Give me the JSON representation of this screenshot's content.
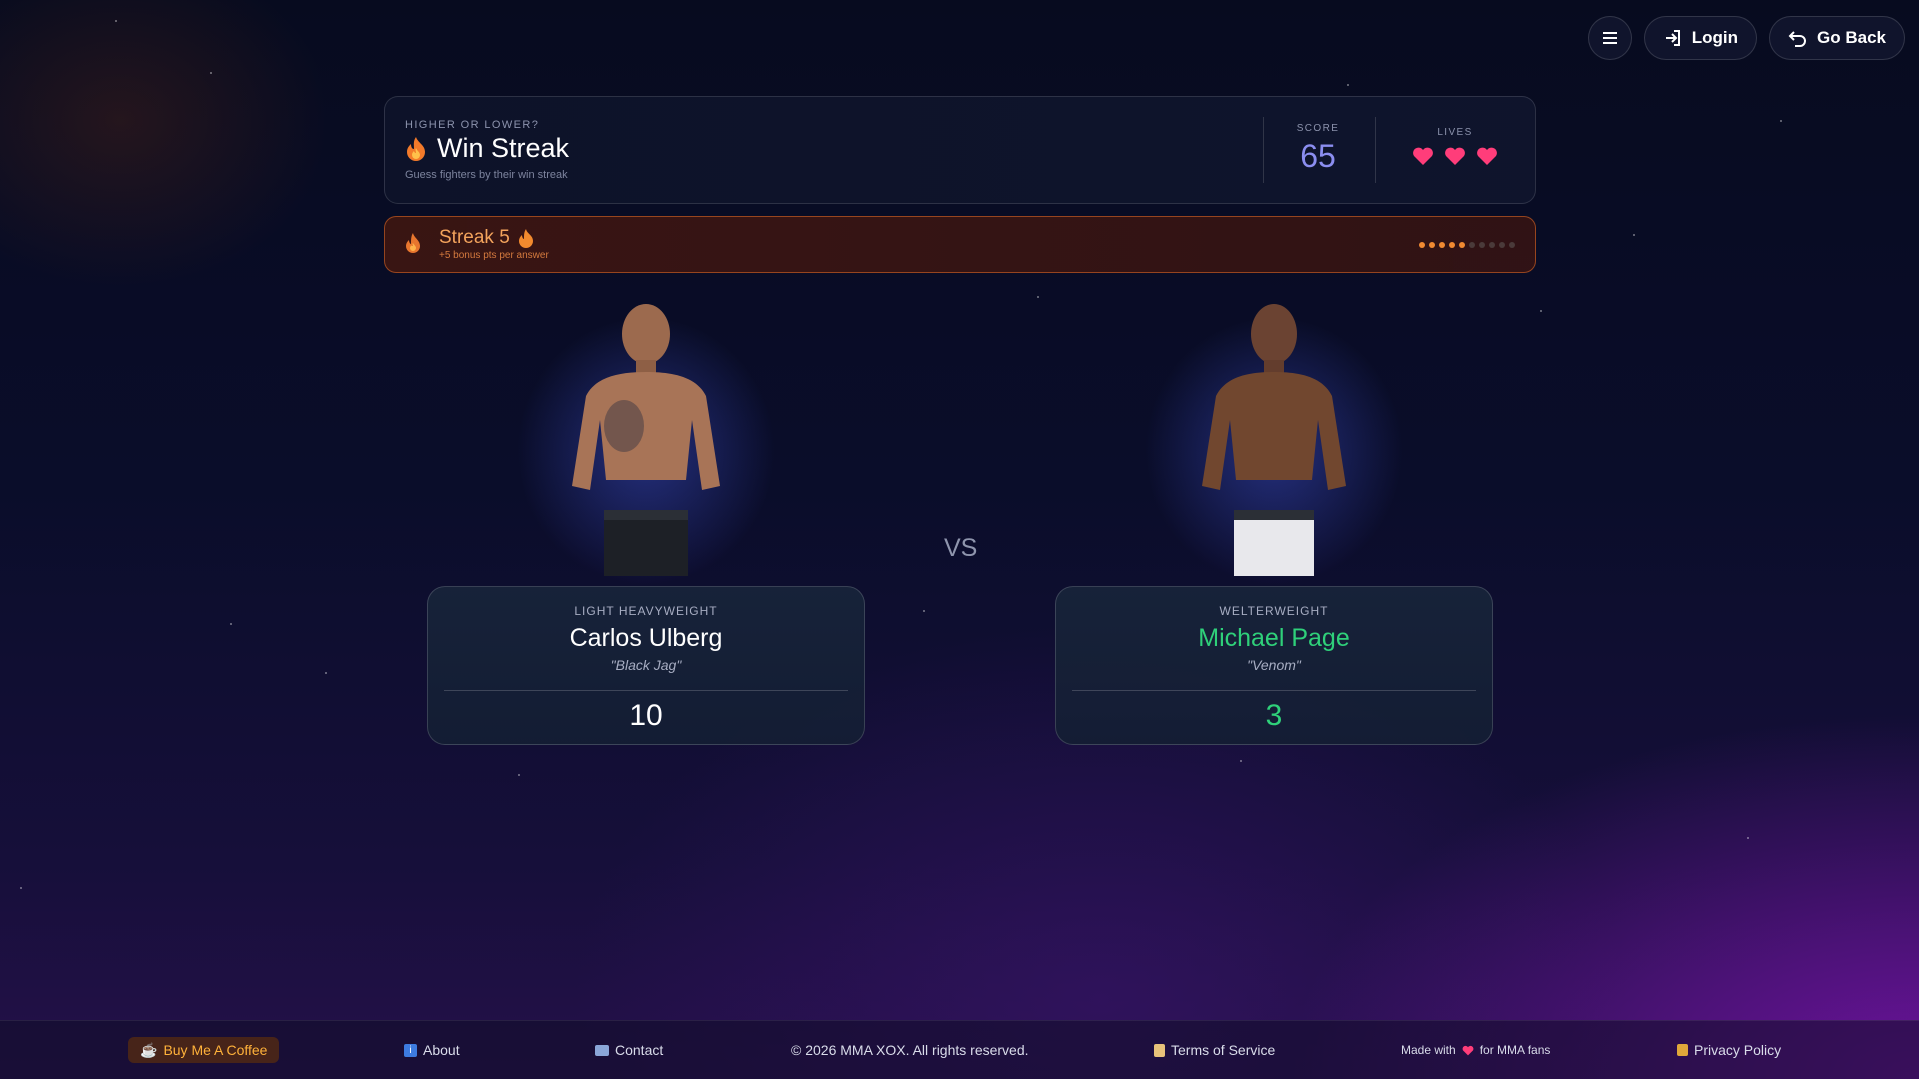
{
  "nav": {
    "login_label": "Login",
    "back_label": "Go Back"
  },
  "header": {
    "kicker": "HIGHER OR LOWER?",
    "title": "Win Streak",
    "subtitle": "Guess fighters by their win streak",
    "score_label": "SCORE",
    "score_value": "65",
    "lives_label": "LIVES",
    "lives_count": 3
  },
  "streak": {
    "title": "Streak 5",
    "subtitle": "+5 bonus pts per answer",
    "progress_filled": 5,
    "progress_total": 10
  },
  "fighters": [
    {
      "weight_class": "LIGHT HEAVYWEIGHT",
      "name": "Carlos Ulberg",
      "nickname": "\"Black Jag\"",
      "value": "10"
    },
    {
      "weight_class": "WELTERWEIGHT",
      "name": "Michael Page",
      "nickname": "\"Venom\"",
      "value": "3"
    }
  ],
  "vs_label": "VS",
  "footer": {
    "coffee": "Buy Me A Coffee",
    "about": "About",
    "contact": "Contact",
    "copyright": "© 2026 MMA XOX. All rights reserved.",
    "terms": "Terms of Service",
    "made_with_pre": "Made with",
    "made_with_post": "for MMA fans",
    "privacy": "Privacy Policy"
  },
  "colors": {
    "accent_score": "#8b8ef0",
    "streak_orange": "#f08a32",
    "correct_green": "#2fd07a",
    "heart_pink": "#ff3d7a"
  }
}
